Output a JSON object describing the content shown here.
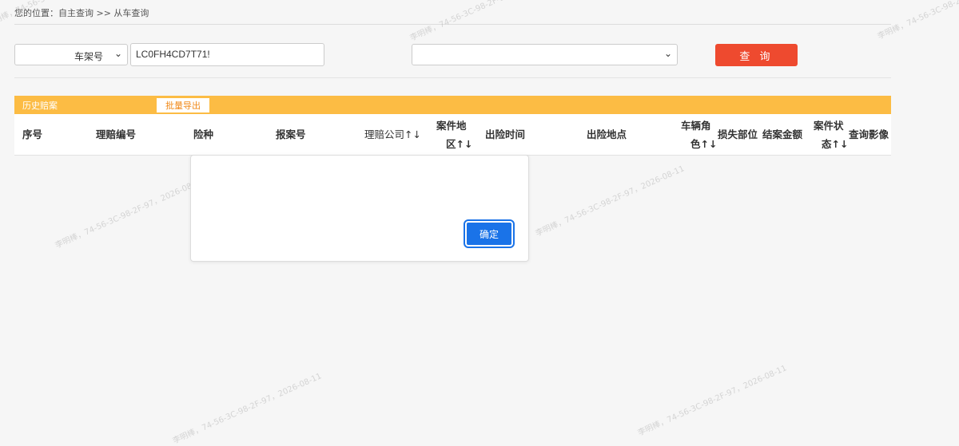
{
  "breadcrumb": "您的位置：自主查询 >> 从车查询",
  "form": {
    "field_type_selected": "车架号",
    "vin_value": "LC0FH4CD7T71!",
    "company_selected": "",
    "search_label": "查 询"
  },
  "results": {
    "title": "历史赔案",
    "export_label": "批量导出",
    "columns": {
      "seq": "序号",
      "claim_no": "理赔编号",
      "insurance_type": "险种",
      "report_no": "报案号",
      "company": "理赔公司↑↓",
      "region_line1": "案件地",
      "region_line2": "区↑↓",
      "time": "出险时间",
      "place": "出险地点",
      "role_line1": "车辆角",
      "role_line2": "色↑↓",
      "damage": "损失部位",
      "amount": "结案金额",
      "status_line1": "案件状",
      "status_line2": "态↑↓",
      "images": "查询影像"
    }
  },
  "dialog": {
    "message": "",
    "ok_label": "确定"
  },
  "watermark": "李明棒，74-56-3C-98-2F-97，2026-08-11",
  "colors": {
    "search_button": "#ee4a2f",
    "results_bar": "#fcbc44",
    "ok_button": "#1a73e8"
  }
}
